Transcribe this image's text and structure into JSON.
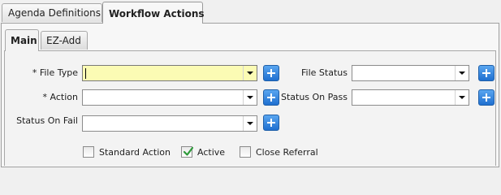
{
  "tabs": [
    {
      "label": "Agenda Definitions",
      "active": false
    },
    {
      "label": "Workflow Actions",
      "active": true
    }
  ],
  "subtabs": [
    {
      "label": "Main",
      "active": true
    },
    {
      "label": "EZ-Add",
      "active": false
    }
  ],
  "form": {
    "file_type": {
      "label": "* File Type",
      "value": ""
    },
    "action": {
      "label": "* Action",
      "value": ""
    },
    "status_on_fail": {
      "label": "Status On Fail",
      "value": ""
    },
    "file_status": {
      "label": "File Status",
      "value": ""
    },
    "status_on_pass": {
      "label": "Status On Pass",
      "value": ""
    }
  },
  "checkboxes": [
    {
      "label": "Standard Action",
      "checked": false
    },
    {
      "label": "Active",
      "checked": true
    },
    {
      "label": "Close Referral",
      "checked": false
    }
  ],
  "icons": {
    "add": "plus-icon",
    "dropdown": "chevron-down-icon",
    "check": "checkmark-icon"
  },
  "colors": {
    "focused_field": "#fbfbb4",
    "add_button": "#2a7ad6",
    "checkmark": "#2e9a3a"
  }
}
